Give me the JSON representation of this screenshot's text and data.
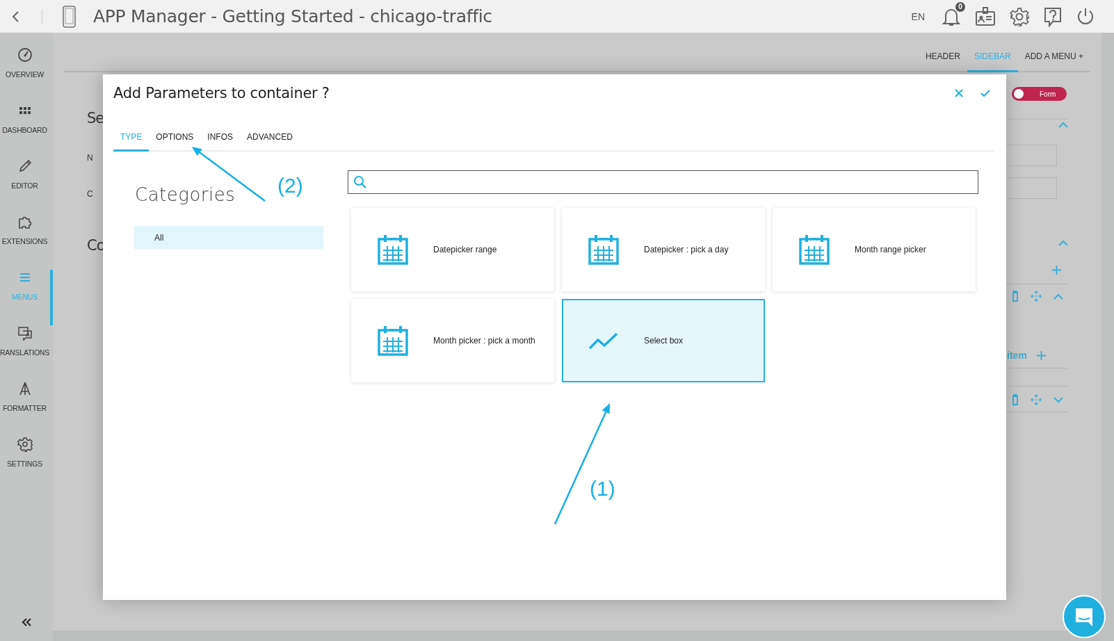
{
  "topbar": {
    "title": "APP Manager - Getting Started - chicago-traffic",
    "language": "EN",
    "notification_count": "0"
  },
  "sidebar": {
    "items": [
      {
        "label": "OVERVIEW",
        "selected": false
      },
      {
        "label": "DASHBOARD",
        "selected": false
      },
      {
        "label": "EDITOR",
        "selected": false
      },
      {
        "label": "EXTENSIONS",
        "selected": false
      },
      {
        "label": "MENUS",
        "selected": true
      },
      {
        "label": "RANSLATIONS",
        "selected": false
      },
      {
        "label": "FORMATTER",
        "selected": false
      },
      {
        "label": "SETTINGS",
        "selected": false
      }
    ]
  },
  "header_tabs": [
    {
      "label": "HEADER",
      "selected": false
    },
    {
      "label": "SIDEBAR",
      "selected": true
    },
    {
      "label": "ADD A MENU +",
      "selected": false
    }
  ],
  "background": {
    "texts": [
      {
        "kind": "heading",
        "text": "Se"
      },
      {
        "kind": "label",
        "text": "N"
      },
      {
        "kind": "label",
        "text": "C"
      },
      {
        "kind": "heading",
        "text": "Co"
      }
    ],
    "toggle": {
      "label": "Form",
      "on": false
    },
    "item_link": "item"
  },
  "dialog": {
    "title": "Add Parameters to container ?",
    "tabs": [
      {
        "label": "TYPE",
        "selected": true
      },
      {
        "label": "OPTIONS",
        "selected": false
      },
      {
        "label": "INFOS",
        "selected": false
      },
      {
        "label": "ADVANCED",
        "selected": false
      }
    ],
    "categories_heading": "Categories",
    "categories": [
      {
        "label": "All",
        "selected": true
      }
    ],
    "cards": [
      {
        "label": "Datepicker range",
        "kind": "calendar",
        "selected": false
      },
      {
        "label": "Datepicker : pick a day",
        "kind": "calendar",
        "selected": false
      },
      {
        "label": "Month range picker",
        "kind": "calendar",
        "selected": false
      },
      {
        "label": "Month picker : pick a month",
        "kind": "calendar",
        "selected": false
      },
      {
        "label": "Select box",
        "kind": "chart",
        "selected": true
      }
    ]
  },
  "annotations": [
    {
      "label": "(2)"
    },
    {
      "label": "(1)"
    }
  ]
}
